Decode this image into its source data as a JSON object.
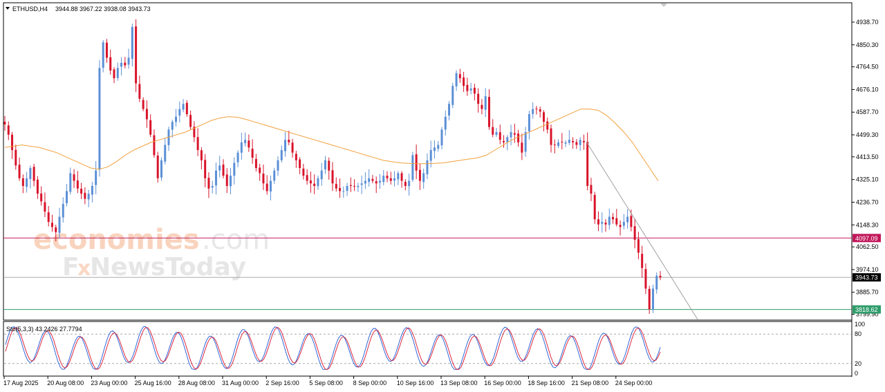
{
  "header": {
    "symbol": "ETHUSD,H4",
    "ohlc": "3944.88 3967.22 3938.08 3943.73"
  },
  "watermark": {
    "line1_brand": "economies",
    "line1_suffix": ".com",
    "line2_a": "F",
    "line2_x": "x",
    "line2_b": "NewsToday"
  },
  "oscillator": {
    "label": "Sto(5,3,3) 43.2426 27.7794",
    "levels": [
      100,
      80,
      20,
      0
    ],
    "level_labels": [
      "100",
      "80",
      "20",
      "0"
    ]
  },
  "colors": {
    "bull": "#5b8fd6",
    "bear": "#d8132a",
    "ma": "#f2a03c",
    "resistance": "#c2185b",
    "support": "#2e9d6a",
    "current": "#9e9e9e",
    "trendline": "#a0a0a0",
    "stoch_main": "#1e57d6",
    "stoch_signal": "#d8132a"
  },
  "chart_data": {
    "type": "candlestick",
    "symbol": "ETHUSD",
    "timeframe": "H4",
    "ylim": [
      3799.9,
      4990
    ],
    "y_ticks": [
      "4938.70",
      "4850.30",
      "4764.50",
      "4676.10",
      "4587.70",
      "4499.30",
      "4413.50",
      "4325.10",
      "4236.70",
      "4148.30",
      "4062.50",
      "3974.10",
      "3885.70",
      "3799.90"
    ],
    "x_ticks": [
      "17 Aug 2025",
      "20 Aug 08:00",
      "23 Aug 00:00",
      "25 Aug 16:00",
      "28 Aug 08:00",
      "31 Aug 00:00",
      "2 Sep 16:00",
      "5 Sep 08:00",
      "8 Sep 00:00",
      "10 Sep 16:00",
      "13 Sep 08:00",
      "16 Sep 00:00",
      "18 Sep 16:00",
      "21 Sep 08:00",
      "24 Sep 00:00"
    ],
    "current_price": 3943.73,
    "current_label": "3943.73",
    "horizontal_levels": [
      {
        "name": "resistance",
        "value": 4097.09,
        "label": "4097.09"
      },
      {
        "name": "support",
        "value": 3818.62,
        "label": "3818.62"
      }
    ],
    "closes": [
      4540,
      4500,
      4440,
      4380,
      4330,
      4300,
      4330,
      4370,
      4320,
      4270,
      4240,
      4200,
      4160,
      4140,
      4120,
      4180,
      4230,
      4280,
      4350,
      4320,
      4290,
      4270,
      4250,
      4270,
      4300,
      4360,
      4760,
      4860,
      4800,
      4750,
      4720,
      4760,
      4780,
      4770,
      4800,
      4920,
      4700,
      4640,
      4600,
      4560,
      4500,
      4420,
      4330,
      4400,
      4460,
      4520,
      4550,
      4570,
      4600,
      4620,
      4580,
      4530,
      4490,
      4440,
      4400,
      4330,
      4290,
      4300,
      4360,
      4380,
      4340,
      4300,
      4340,
      4390,
      4430,
      4470,
      4480,
      4450,
      4410,
      4370,
      4350,
      4310,
      4280,
      4320,
      4360,
      4400,
      4440,
      4480,
      4470,
      4430,
      4400,
      4370,
      4340,
      4320,
      4310,
      4300,
      4330,
      4360,
      4400,
      4360,
      4310,
      4290,
      4280,
      4280,
      4300,
      4300,
      4300,
      4300,
      4310,
      4320,
      4330,
      4320,
      4310,
      4320,
      4340,
      4330,
      4320,
      4330,
      4350,
      4320,
      4300,
      4320,
      4420,
      4360,
      4320,
      4350,
      4400,
      4440,
      4450,
      4460,
      4520,
      4570,
      4620,
      4690,
      4740,
      4720,
      4690,
      4670,
      4680,
      4660,
      4620,
      4600,
      4650,
      4530,
      4500,
      4510,
      4480,
      4470,
      4490,
      4510,
      4500,
      4470,
      4430,
      4510,
      4580,
      4600,
      4600,
      4590,
      4550,
      4520,
      4460,
      4460,
      4470,
      4470,
      4470,
      4480,
      4470,
      4460,
      4480,
      4470,
      4300,
      4270,
      4170,
      4150,
      4160,
      4150,
      4180,
      4170,
      4150,
      4140,
      4160,
      4180,
      4140,
      4090,
      4040,
      3980,
      3900,
      3820,
      3900,
      3950,
      3943.73
    ],
    "ma": [
      4450,
      4455,
      4460,
      4455,
      4450,
      4440,
      4430,
      4415,
      4400,
      4385,
      4370,
      4365,
      4375,
      4395,
      4420,
      4440,
      4455,
      4470,
      4480,
      4490,
      4500,
      4510,
      4525,
      4540,
      4555,
      4565,
      4570,
      4568,
      4560,
      4550,
      4540,
      4530,
      4520,
      4510,
      4500,
      4490,
      4480,
      4470,
      4460,
      4450,
      4440,
      4430,
      4420,
      4410,
      4400,
      4395,
      4390,
      4388,
      4387,
      4387,
      4388,
      4390,
      4395,
      4400,
      4405,
      4410,
      4420,
      4440,
      4460,
      4480,
      4495,
      4510,
      4525,
      4540,
      4555,
      4570,
      4585,
      4600,
      4600,
      4595,
      4575,
      4545,
      4510,
      4470,
      4420,
      4370,
      4320
    ]
  }
}
